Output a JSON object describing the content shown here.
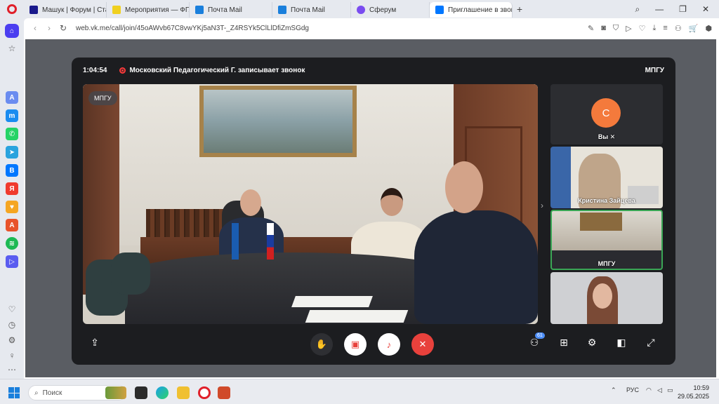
{
  "browser": {
    "tabs": [
      {
        "label": "Машук | Форум | Ставроп",
        "color": "#1a1a8c"
      },
      {
        "label": "Мероприятия — ФГАИС",
        "color": "#f0d020"
      },
      {
        "label": "Почта Mail",
        "color": "#1a7fdc"
      },
      {
        "label": "Почта Mail",
        "color": "#1a7fdc"
      },
      {
        "label": "Сферум",
        "color": "#7a4cf0"
      },
      {
        "label": "Приглашение в звонк",
        "color": "#0077ff",
        "active": true
      }
    ],
    "url": "web.vk.me/call/join/45oAWvb67C8vwYKj5aN3T-_Z4RSYk5ClLlDfiZmSGdg"
  },
  "call": {
    "timer": "1:04:54",
    "recording_text": "Московский Педагогический Г. записывает звонок",
    "org_label": "МПГУ",
    "main_video_label": "МПГУ",
    "participants": [
      {
        "avatar_letter": "С",
        "name": "Вы"
      },
      {
        "name": "Кристина Зайцева"
      },
      {
        "name": "МПГУ"
      },
      {
        "name": ""
      }
    ],
    "participant_count": "61"
  },
  "taskbar": {
    "search_placeholder": "Поиск",
    "language": "РУС",
    "time": "10:59",
    "date": "29.05.2025"
  },
  "colors": {
    "accent": "#0077ff",
    "end_call": "#e8413c",
    "avatar": "#f47a3c"
  }
}
